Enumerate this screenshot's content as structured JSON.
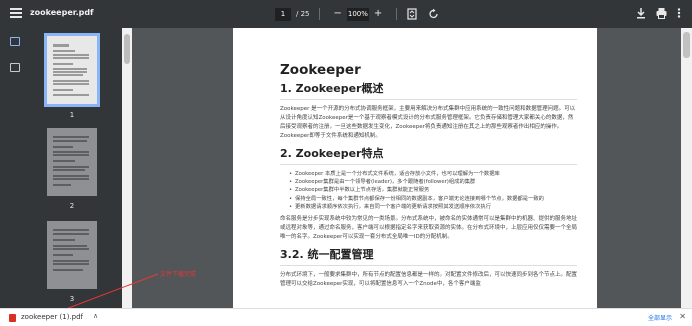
{
  "toolbar": {
    "title": "zookeeper.pdf",
    "current_page": "1",
    "total_pages": "/ 25",
    "zoom": "100%",
    "zoom_out": "−",
    "zoom_in": "+"
  },
  "thumbnails": [
    {
      "number": "1",
      "selected": true
    },
    {
      "number": "2",
      "selected": false
    },
    {
      "number": "3",
      "selected": false
    }
  ],
  "document": {
    "title": "Zookeeper",
    "section1_title": "1. Zookeeper概述",
    "section1_text": "Zookeeper 是一个开源的分布式协调服务框架，主要用来解决分布式集群中应用系统的一致性问题和数据管理问题。可以从设计角度认知Zookeeper是一个基于观察者模式设计的分布式服务管理框架。它负责存储和管理大家都关心的数据，然后接受观察者的注册，一旦这些数据发生变化，Zookeeper将负责通知注册在其之上的那些观察者作出相应的操作。Zookeeper即等于文件系统和通知机制。",
    "section2_title": "2. Zookeeper特点",
    "section2_bullets": [
      "Zookeeper 本质上是一个分布式文件系统，适合存放小文件，也可以理解为一个数据库",
      "Zookeeper集群是由一个领导者(leader)，多个跟随者(follower)组成的集群",
      "Zookeeper集群中半数以上节点存活，集群就能正常服务",
      "保持全局一致性，每个集群节点都保存一份相同的数据副本，客户端无论连接到哪个节点，数据都是一致的",
      "更新数据请求顺序依次执行，来自同一个客户端的更新请求按照其发送顺序依次执行"
    ],
    "section2_text": "命名服务是分步实现系统中较为常见的一类场景。分布式系统中，被命名的实体通常可以是集群中的机器、提供的服务地址或远程对象等，通过命名服务，客户端可以根据指定名字来获取资源的实体。在分布式环境中，上层应用仅仅需要一个全局唯一的名字。Zookeeper可以实现一套分布式全局唯一ID的分配机制。",
    "section3_title": "3.2. 统一配置管理",
    "section3_text": "分布式环境下，一般要求集群中，所有节点的配置信息都是一样的。对配置文件修改后，可以快速同步到各个节点上。配置管理可以交给Zookeeper实现，可以将配置信息写入一个Znode中，各个客户端监"
  },
  "annotation": {
    "text": "文件下载完成"
  },
  "downloads": {
    "file_name": "zookeeper (1).pdf",
    "show_all": "全部显示",
    "chevron": "∧",
    "close": "✕"
  },
  "colors": {
    "toolbar_bg": "#323639",
    "viewer_bg": "#525659",
    "accent": "#8ab4f8",
    "annotation": "#e53935",
    "link": "#1a73e8"
  }
}
